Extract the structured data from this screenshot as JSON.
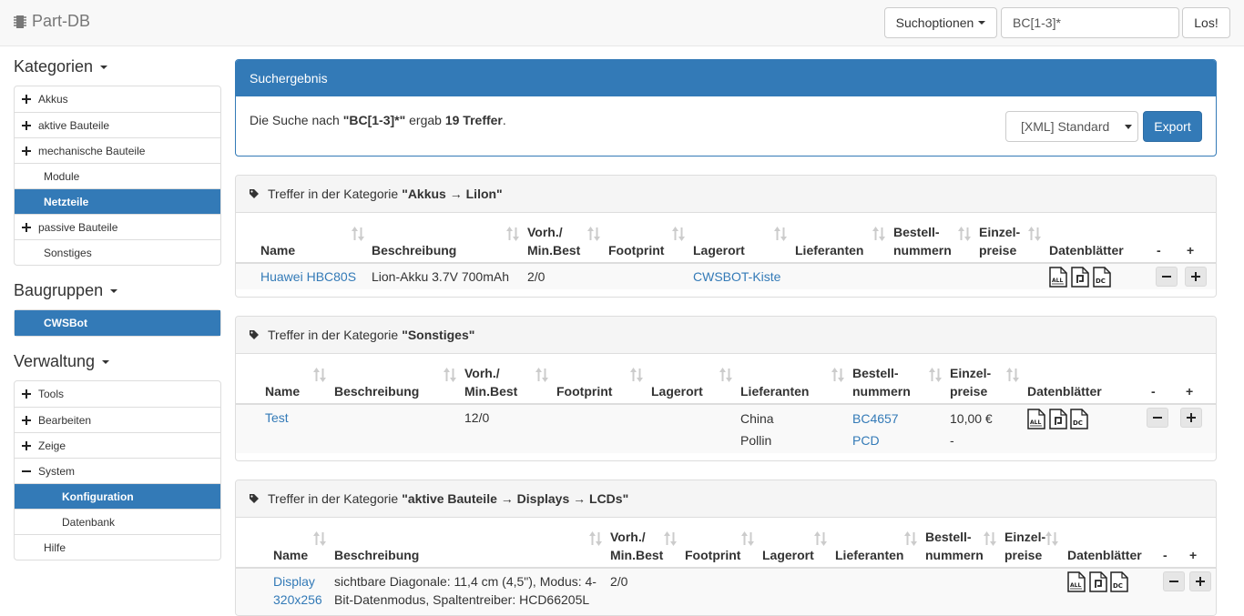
{
  "navbar": {
    "brand": "Part-DB",
    "search_options_label": "Suchoptionen",
    "search_value": "BC[1-3]*",
    "go_label": "Los!"
  },
  "sidebar": {
    "categories": {
      "heading": "Kategorien",
      "items": [
        {
          "label": "Akkus"
        },
        {
          "label": "aktive Bauteile"
        },
        {
          "label": "mechanische Bauteile"
        },
        {
          "label": "Module"
        },
        {
          "label": "Netzteile"
        },
        {
          "label": "passive Bauteile"
        },
        {
          "label": "Sonstiges"
        }
      ]
    },
    "assemblies": {
      "heading": "Baugruppen",
      "items": [
        {
          "label": "CWSBot"
        }
      ]
    },
    "admin": {
      "heading": "Verwaltung",
      "items": [
        {
          "label": "Tools"
        },
        {
          "label": "Bearbeiten"
        },
        {
          "label": "Zeige"
        },
        {
          "label": "System"
        },
        {
          "label": "Konfiguration"
        },
        {
          "label": "Datenbank"
        },
        {
          "label": "Hilfe"
        }
      ]
    }
  },
  "result": {
    "title": "Suchergebnis",
    "text_prefix": "Die Suche nach ",
    "query": "\"BC[1-3]*\"",
    "text_mid": " ergab ",
    "count": "19 Treffer",
    "text_suffix": ".",
    "export_format": "[XML] Standard",
    "export_label": "Export"
  },
  "columns": {
    "name": "Name",
    "description": "Beschreibung",
    "stock_1": "Vorh./",
    "stock_2": "Min.Best",
    "footprint": "Footprint",
    "storage": "Lagerort",
    "suppliers": "Lieferanten",
    "order_1": "Bestell-",
    "order_2": "nummern",
    "price_1": "Einzel-",
    "price_2": "preise",
    "datasheets": "Datenblätter",
    "minus": "-",
    "plus": "+"
  },
  "groups": [
    {
      "prefix": "Treffer in der Kategorie",
      "category": "\"Akkus → Lilon\"",
      "rows": [
        {
          "name": "Huawei HBC80S",
          "description": "Lion-Akku 3.7V 700mAh",
          "stock": "2/0",
          "storage": "CWSBOT-Kiste"
        }
      ]
    },
    {
      "prefix": "Treffer in der Kategorie",
      "category": "\"Sonstiges\"",
      "rows": [
        {
          "name": "Test",
          "stock": "12/0",
          "supplier_1": "China",
          "supplier_2": "Pollin",
          "order_1": "BC4657",
          "order_2": "PCD",
          "price_1": "10,00 €",
          "price_2": "-"
        }
      ]
    },
    {
      "prefix": "Treffer in der Kategorie",
      "category": "\"aktive Bauteile → Displays → LCDs\"",
      "rows": [
        {
          "name_1": "Display",
          "name_2": "320x256",
          "description_1": "sichtbare Diagonale: 11,4 cm (4,5\"), Modus: 4-",
          "description_2": "Bit-Datenmodus, Spaltentreiber: HCD66205L",
          "stock": "2/0"
        }
      ]
    }
  ],
  "icons": {
    "sort": "sort-icon",
    "tag": "tag-icon",
    "datasheet_1": "alldatasheet-icon",
    "datasheet_2": "datasheet-file-icon",
    "datasheet_3": "datasheet-doc-icon"
  },
  "colors": {
    "primary": "#337ab7",
    "navbar_bg": "#f8f8f8",
    "panel_header_bg": "#f5f5f5"
  }
}
